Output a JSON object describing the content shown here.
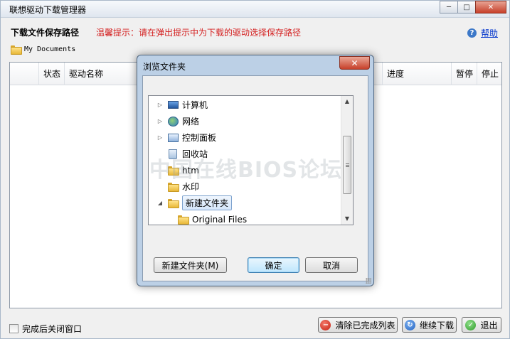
{
  "window": {
    "title": "联想驱动下载管理器",
    "min": "─",
    "max": "□",
    "close": "✕"
  },
  "header": {
    "save_label": "下载文件保存路径",
    "hint": "温馨提示：请在弹出提示中为下载的驱动选择保存路径",
    "help": "帮助",
    "help_icon": "?"
  },
  "path": {
    "value": "My Documents"
  },
  "list": {
    "columns": [
      "状态",
      "驱动名称",
      "进度",
      "暂停",
      "停止"
    ]
  },
  "footer": {
    "close_after": "完成后关闭窗口",
    "clear_btn": "清除已完成列表",
    "continue_btn": "继续下载",
    "exit_btn": "退出",
    "clear_icon": "−",
    "continue_icon": "↻",
    "exit_icon": "✓"
  },
  "dialog": {
    "title": "浏览文件夹",
    "close": "✕",
    "tree": [
      {
        "label": "计算机",
        "icon": "computer-icon",
        "arrow": "▷"
      },
      {
        "label": "网络",
        "icon": "network-icon",
        "arrow": "▷"
      },
      {
        "label": "控制面板",
        "icon": "control-panel-icon",
        "arrow": "▷"
      },
      {
        "label": "回收站",
        "icon": "recycle-bin-icon",
        "arrow": ""
      },
      {
        "label": "htm",
        "icon": "folder-icon",
        "arrow": ""
      },
      {
        "label": "水印",
        "icon": "folder-icon",
        "arrow": ""
      },
      {
        "label": "新建文件夹",
        "icon": "folder-icon",
        "arrow": "◢",
        "selected": true
      },
      {
        "label": "Original Files",
        "icon": "folder-icon",
        "arrow": ""
      }
    ],
    "scroll_up": "▲",
    "scroll_down": "▼",
    "new_folder_btn": "新建文件夹(M)",
    "ok_btn": "确定",
    "cancel_btn": "取消"
  },
  "watermark": "中国在线BIOS论坛"
}
